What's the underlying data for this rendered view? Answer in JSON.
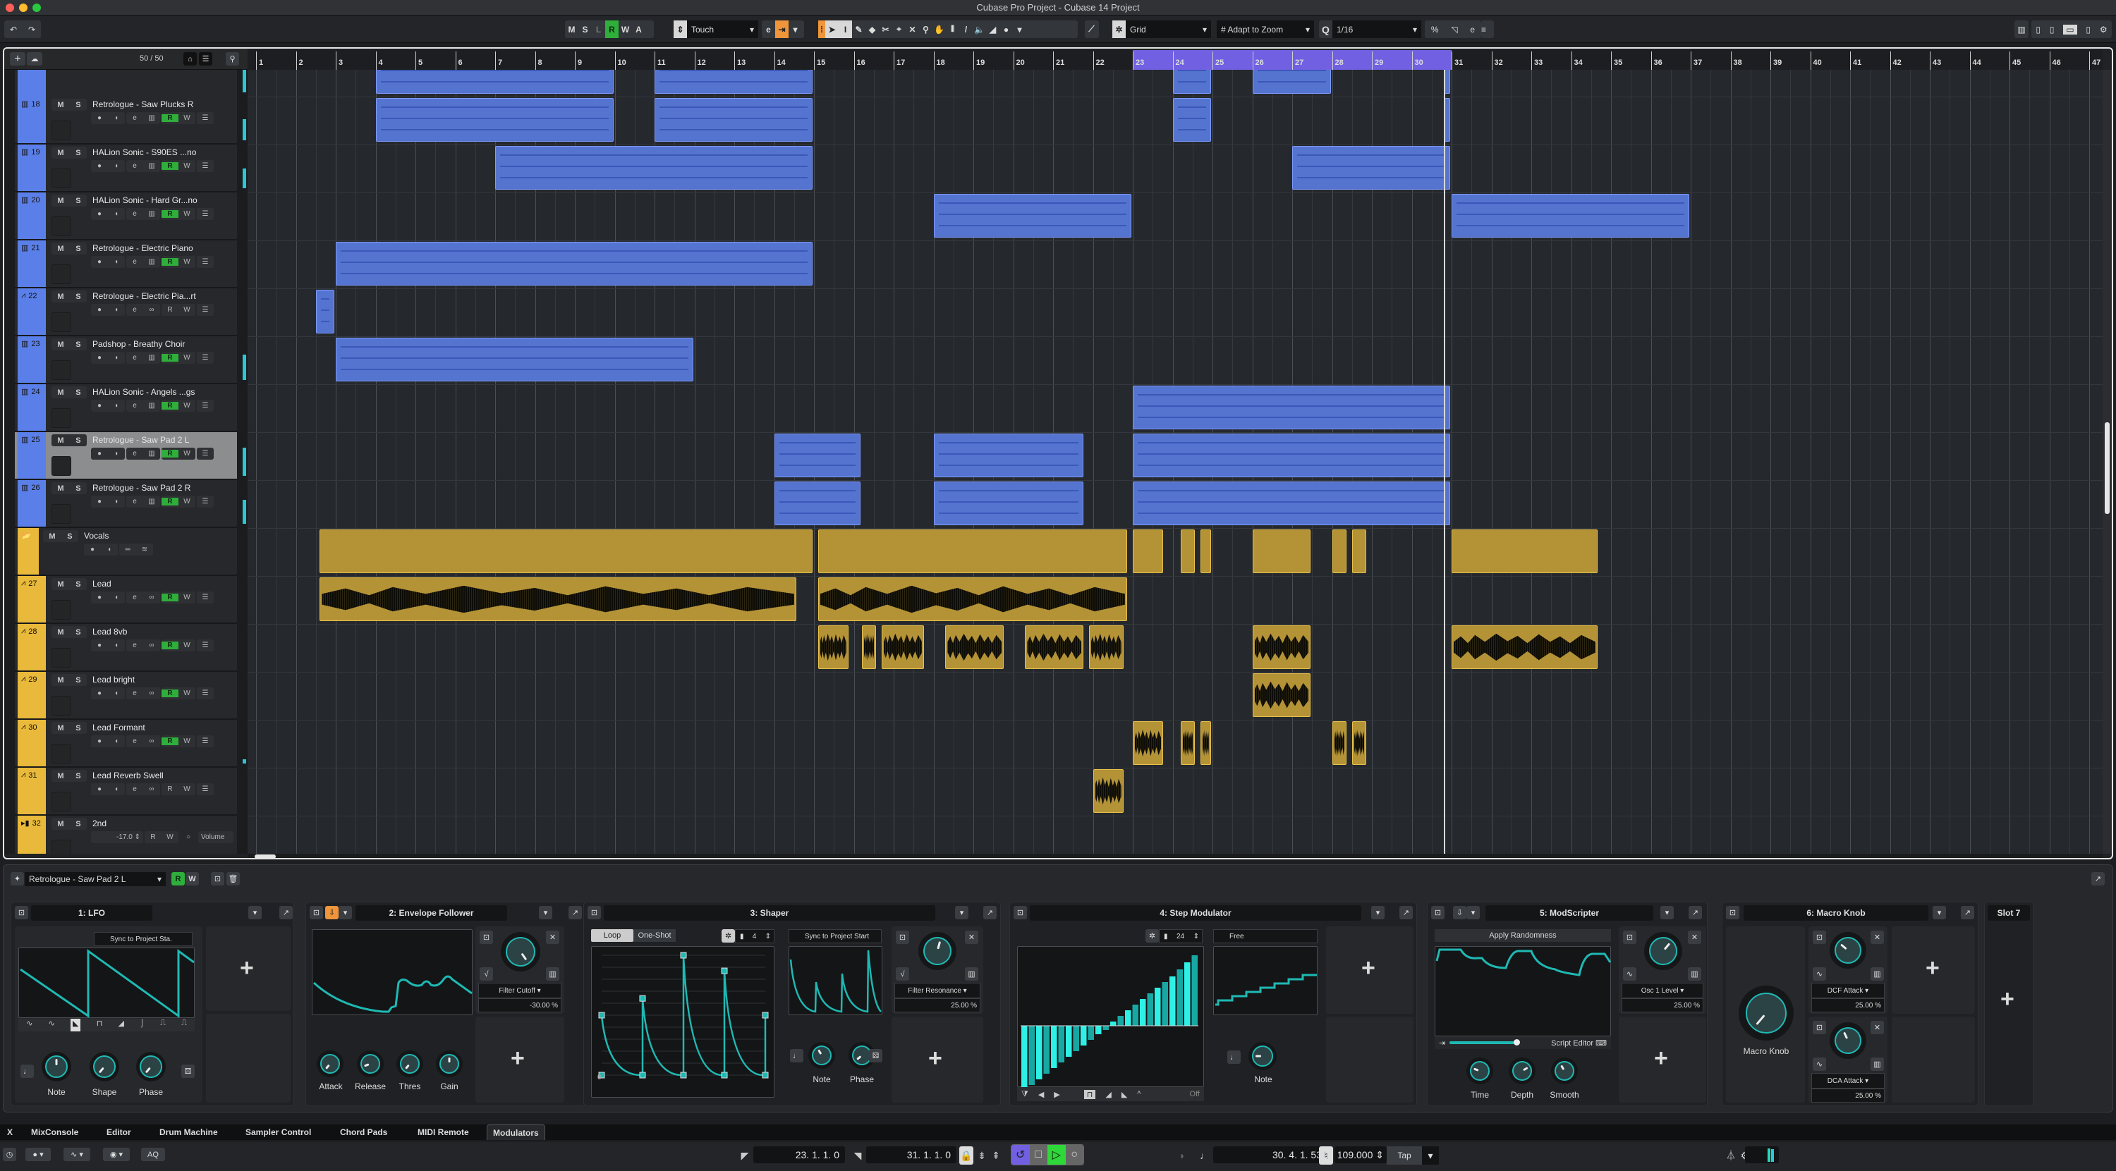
{
  "window": {
    "title": "Cubase Pro Project - Cubase 14 Project"
  },
  "toolbar": {
    "undo_icon": "↶",
    "redo_icon": "↷",
    "state_buttons": [
      "M",
      "S",
      "L",
      "R",
      "W",
      "A"
    ],
    "automation_mode": "Touch",
    "snap_type": "Grid",
    "grid_mode": "Adapt to Zoom",
    "quantize_label": "Q",
    "quantize_value": "1/16"
  },
  "tracklist": {
    "add_icon": "+",
    "track_count": "50 / 50",
    "tracks": [
      {
        "num": "18",
        "name": "Retrologue - Saw Plucks R",
        "type": "instrument",
        "color": "#5b7fe8",
        "rec_on": true
      },
      {
        "num": "19",
        "name": "HALion Sonic - S90ES ...no",
        "type": "instrument",
        "color": "#5b7fe8",
        "rec_on": true
      },
      {
        "num": "20",
        "name": "HALion Sonic - Hard Gr...no",
        "type": "instrument",
        "color": "#5b7fe8",
        "rec_on": true
      },
      {
        "num": "21",
        "name": "Retrologue - Electric Piano",
        "type": "instrument",
        "color": "#5b7fe8",
        "rec_on": true
      },
      {
        "num": "22",
        "name": "Retrologue - Electric Pia...rt",
        "type": "audio",
        "color": "#5b7fe8",
        "rec_on": false
      },
      {
        "num": "23",
        "name": "Padshop - Breathy Choir",
        "type": "instrument",
        "color": "#5b7fe8",
        "rec_on": true
      },
      {
        "num": "24",
        "name": "HALion Sonic - Angels ...gs",
        "type": "instrument",
        "color": "#5b7fe8",
        "rec_on": true
      },
      {
        "num": "25",
        "name": "Retrologue - Saw Pad 2 L",
        "type": "instrument",
        "color": "#5b7fe8",
        "rec_on": true,
        "selected": true
      },
      {
        "num": "26",
        "name": "Retrologue - Saw Pad 2 R",
        "type": "instrument",
        "color": "#5b7fe8",
        "rec_on": true
      },
      {
        "num": "",
        "name": "Vocals",
        "type": "folder",
        "color": "#e8b93a",
        "rec_on": false
      },
      {
        "num": "27",
        "name": "Lead",
        "type": "audio",
        "color": "#e8b93a",
        "rec_on": true
      },
      {
        "num": "28",
        "name": "Lead 8vb",
        "type": "audio",
        "color": "#e8b93a",
        "rec_on": true
      },
      {
        "num": "29",
        "name": "Lead bright",
        "type": "audio",
        "color": "#e8b93a",
        "rec_on": true
      },
      {
        "num": "30",
        "name": "Lead Formant",
        "type": "audio",
        "color": "#e8b93a",
        "rec_on": true
      },
      {
        "num": "31",
        "name": "Lead Reverb Swell",
        "type": "audio",
        "color": "#e8b93a",
        "rec_on": false
      },
      {
        "num": "32",
        "name": "2nd",
        "type": "fx",
        "color": "#e8b93a",
        "rec_on": false,
        "volume": "-17.0",
        "param": "Volume"
      }
    ],
    "mute_label": "M",
    "solo_label": "S",
    "read_label": "R",
    "write_label": "W"
  },
  "ruler": {
    "bars": [
      "1",
      "2",
      "3",
      "4",
      "5",
      "6",
      "7",
      "8",
      "9",
      "10",
      "11",
      "12",
      "13",
      "14",
      "15",
      "16",
      "17",
      "18",
      "19",
      "20",
      "21",
      "22",
      "23",
      "24",
      "25",
      "26",
      "27",
      "28",
      "29",
      "30",
      "31",
      "32",
      "33",
      "34",
      "35",
      "36",
      "37",
      "38",
      "39",
      "40",
      "41",
      "42",
      "43",
      "44",
      "45",
      "46",
      "47"
    ],
    "cycle_start": 23,
    "cycle_end": 31
  },
  "arrangement": {
    "playhead_bar": 30.8,
    "events": [
      {
        "row": -1,
        "start": 4,
        "end": 10,
        "kind": "midi"
      },
      {
        "row": -1,
        "start": 11,
        "end": 15,
        "kind": "midi"
      },
      {
        "row": -1,
        "start": 24,
        "end": 25,
        "kind": "midi"
      },
      {
        "row": -1,
        "start": 26,
        "end": 28,
        "kind": "midi"
      },
      {
        "row": -1,
        "start": 30.8,
        "end": 31,
        "kind": "midi"
      },
      {
        "row": 0,
        "start": 4,
        "end": 10,
        "kind": "midi"
      },
      {
        "row": 0,
        "start": 11,
        "end": 15,
        "kind": "midi"
      },
      {
        "row": 0,
        "start": 24,
        "end": 25,
        "kind": "midi"
      },
      {
        "row": 0,
        "start": 30.8,
        "end": 31,
        "kind": "midi"
      },
      {
        "row": 1,
        "start": 7,
        "end": 15,
        "kind": "midi"
      },
      {
        "row": 1,
        "start": 27,
        "end": 31,
        "kind": "midi"
      },
      {
        "row": 2,
        "start": 18,
        "end": 23,
        "kind": "midi"
      },
      {
        "row": 2,
        "start": 31,
        "end": 37,
        "kind": "midi"
      },
      {
        "row": 3,
        "start": 3,
        "end": 15,
        "kind": "midi"
      },
      {
        "row": 4,
        "start": 2.5,
        "end": 3,
        "kind": "midi"
      },
      {
        "row": 5,
        "start": 3,
        "end": 12,
        "kind": "midi"
      },
      {
        "row": 6,
        "start": 23,
        "end": 31,
        "kind": "midi"
      },
      {
        "row": 7,
        "start": 14,
        "end": 16.2,
        "kind": "midi"
      },
      {
        "row": 7,
        "start": 18,
        "end": 21.8,
        "kind": "midi"
      },
      {
        "row": 7,
        "start": 23,
        "end": 31,
        "kind": "midi"
      },
      {
        "row": 8,
        "start": 14,
        "end": 16.2,
        "kind": "midi"
      },
      {
        "row": 8,
        "start": 18,
        "end": 21.8,
        "kind": "midi"
      },
      {
        "row": 8,
        "start": 23,
        "end": 31,
        "kind": "midi"
      },
      {
        "row": 9,
        "start": 2.6,
        "end": 15,
        "kind": "folder"
      },
      {
        "row": 9,
        "start": 15.1,
        "end": 22.9,
        "kind": "folder"
      },
      {
        "row": 9,
        "start": 23,
        "end": 23.8,
        "kind": "folder"
      },
      {
        "row": 9,
        "start": 24.2,
        "end": 24.6,
        "kind": "folder"
      },
      {
        "row": 9,
        "start": 24.7,
        "end": 25,
        "kind": "folder"
      },
      {
        "row": 9,
        "start": 26,
        "end": 27.5,
        "kind": "folder"
      },
      {
        "row": 9,
        "start": 28,
        "end": 28.4,
        "kind": "folder"
      },
      {
        "row": 9,
        "start": 28.5,
        "end": 28.9,
        "kind": "folder"
      },
      {
        "row": 9,
        "start": 31,
        "end": 34.7,
        "kind": "folder"
      },
      {
        "row": 10,
        "start": 2.6,
        "end": 14.6,
        "kind": "audio"
      },
      {
        "row": 10,
        "start": 15.1,
        "end": 22.9,
        "kind": "audio"
      },
      {
        "row": 11,
        "start": 15.1,
        "end": 15.9,
        "kind": "audio"
      },
      {
        "row": 11,
        "start": 16.2,
        "end": 16.6,
        "kind": "audio"
      },
      {
        "row": 11,
        "start": 16.7,
        "end": 17.8,
        "kind": "audio"
      },
      {
        "row": 11,
        "start": 18.3,
        "end": 19.8,
        "kind": "audio"
      },
      {
        "row": 11,
        "start": 20.3,
        "end": 21.8,
        "kind": "audio"
      },
      {
        "row": 11,
        "start": 21.9,
        "end": 22.8,
        "kind": "audio"
      },
      {
        "row": 11,
        "start": 26,
        "end": 27.5,
        "kind": "audio"
      },
      {
        "row": 11,
        "start": 31,
        "end": 34.7,
        "kind": "audio"
      },
      {
        "row": 12,
        "start": 26,
        "end": 27.5,
        "kind": "audio"
      },
      {
        "row": 13,
        "start": 23,
        "end": 23.8,
        "kind": "audio"
      },
      {
        "row": 13,
        "start": 24.2,
        "end": 24.6,
        "kind": "audio"
      },
      {
        "row": 13,
        "start": 24.7,
        "end": 25,
        "kind": "audio"
      },
      {
        "row": 13,
        "start": 28,
        "end": 28.4,
        "kind": "audio"
      },
      {
        "row": 13,
        "start": 28.5,
        "end": 28.9,
        "kind": "audio"
      },
      {
        "row": 14,
        "start": 22,
        "end": 22.8,
        "kind": "audio"
      }
    ]
  },
  "lower_zone": {
    "track_selector": "Retrologue - Saw Pad 2 L",
    "read_label": "R",
    "write_label": "W",
    "modulators": [
      {
        "title": "1: LFO",
        "sync": "Sync to Project Sta.",
        "knobs": [
          "Note",
          "Shape",
          "Phase"
        ]
      },
      {
        "title": "2: Envelope Follower",
        "target": "Filter Cutoff",
        "amount": "-30.00 %",
        "knobs": [
          "Attack",
          "Release",
          "Thres",
          "Gain"
        ]
      },
      {
        "title": "3: Shaper",
        "loop": "Loop",
        "oneshot": "One-Shot",
        "nodes": "4",
        "sync": "Sync to Project Start",
        "axis_zero": "0",
        "target": "Filter Resonance",
        "amount": "25.00 %",
        "knobs": [
          "Note",
          "Phase"
        ]
      },
      {
        "title": "4: Step Modulator",
        "steps": "24",
        "sync": "Free",
        "swing": "Off",
        "knobs": [
          "Note"
        ],
        "step_values": [
          -0.92,
          -0.84,
          -0.76,
          -0.68,
          -0.6,
          -0.52,
          -0.44,
          -0.36,
          -0.28,
          -0.2,
          -0.12,
          -0.06,
          0.06,
          0.14,
          0.22,
          0.3,
          0.38,
          0.46,
          0.54,
          0.62,
          0.7,
          0.8,
          0.9,
          1.0
        ]
      },
      {
        "title": "5: ModScripter",
        "script": "Apply Randomness",
        "editor": "Script Editor",
        "target": "Osc 1 Level",
        "amount": "25.00 %",
        "knobs": [
          "Time",
          "Depth",
          "Smooth"
        ]
      },
      {
        "title": "6: Macro Knob",
        "macro_label": "Macro Knob",
        "targets": [
          {
            "name": "DCF Attack",
            "amount": "25.00 %"
          },
          {
            "name": "DCA Attack",
            "amount": "25.00 %"
          }
        ]
      },
      {
        "title": "Slot 7"
      }
    ]
  },
  "tabs": {
    "close_icon": "X",
    "items": [
      "MixConsole",
      "Editor",
      "Drum Machine",
      "Sampler Control",
      "Chord Pads",
      "MIDI Remote",
      "Modulators"
    ],
    "active": "Modulators"
  },
  "transport": {
    "left_locator": "23. 1. 1.   0",
    "right_locator": "31. 1. 1.   0",
    "position": "30.  4.  1.  53",
    "tempo": "109.000",
    "tap": "Tap",
    "aq": "AQ"
  },
  "colors": {
    "accent_teal": "#1fb9b4",
    "record_green": "#2fae3b",
    "cycle_purple": "#7160e2",
    "midi_blue": "#5474cf",
    "audio_gold": "#b49337",
    "edit_orange": "#f0953a"
  }
}
